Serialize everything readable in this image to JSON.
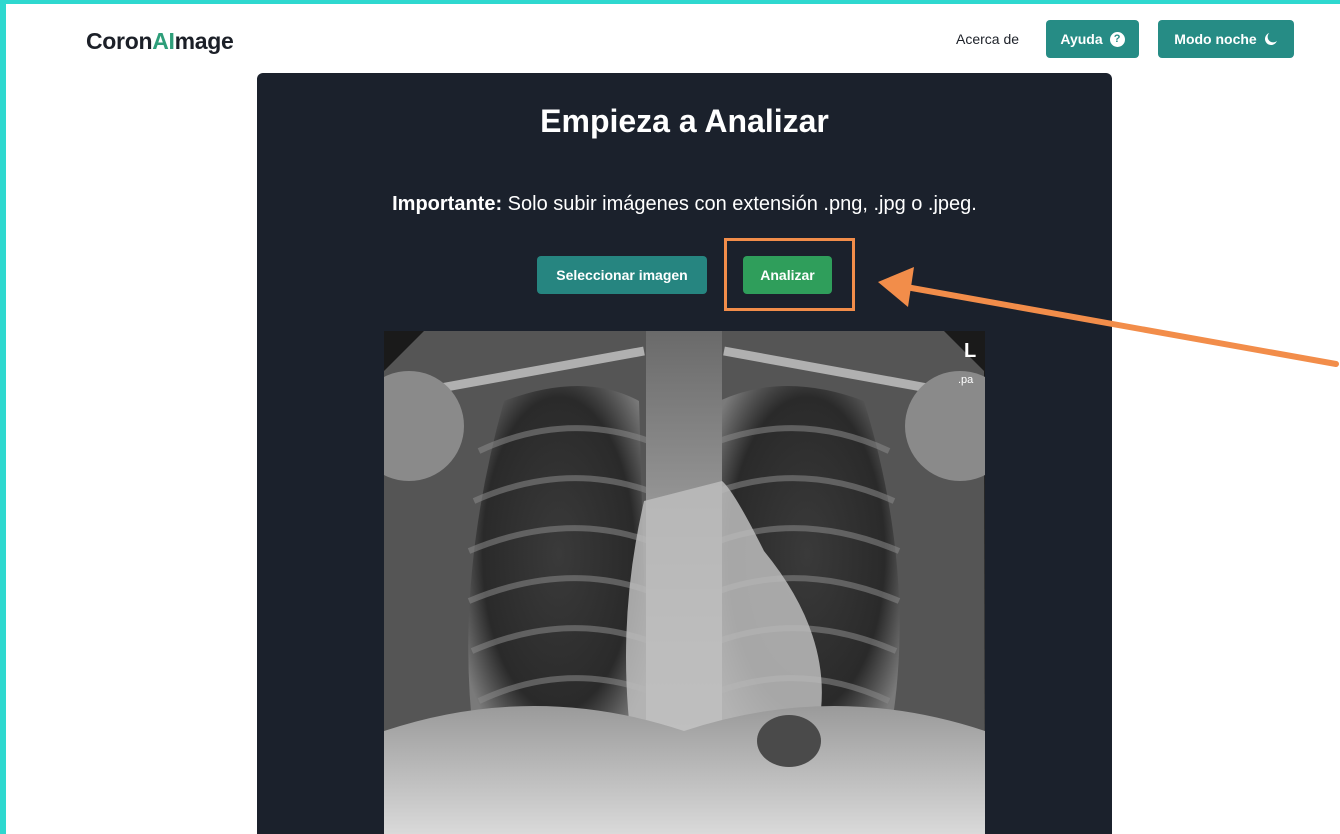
{
  "app": {
    "logo_pre": "Coron",
    "logo_ai": "AI",
    "logo_post": "mage",
    "accent_color": "#2ed8cf",
    "brand_color": "#268c85"
  },
  "nav": {
    "about_label": "Acerca de",
    "help_label": "Ayuda",
    "help_icon": "question-circle-icon",
    "night_label": "Modo noche",
    "night_icon": "moon-icon"
  },
  "main": {
    "title": "Empieza a Analizar",
    "notice_strong": "Importante:",
    "notice_text": "Solo subir imágenes con extensión .png, .jpg o .jpeg.",
    "select_label": "Seleccionar imagen",
    "analyze_label": "Analizar",
    "analyze_color": "#2f9e5b",
    "highlight_color": "#f28d4a"
  },
  "image": {
    "marker_letter": "L",
    "marker_sub": ".pa"
  }
}
